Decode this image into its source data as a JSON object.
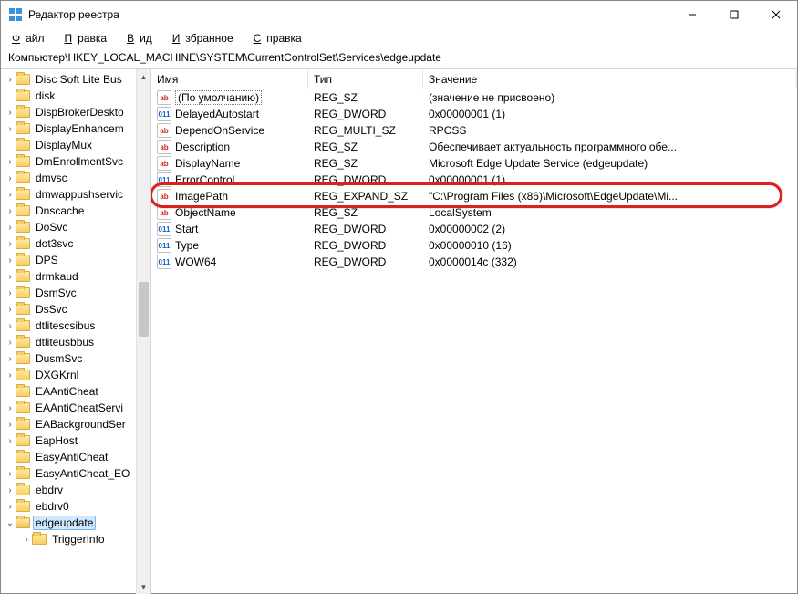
{
  "window": {
    "title": "Редактор реестра"
  },
  "menu": {
    "file": "Файл",
    "edit": "Правка",
    "view": "Вид",
    "favorites": "Избранное",
    "help": "Справка"
  },
  "address": "Компьютер\\HKEY_LOCAL_MACHINE\\SYSTEM\\CurrentControlSet\\Services\\edgeupdate",
  "tree": [
    {
      "label": "Disc Soft Lite Bus",
      "exp": true
    },
    {
      "label": "disk",
      "exp": false
    },
    {
      "label": "DispBrokerDeskto",
      "exp": true
    },
    {
      "label": "DisplayEnhancem",
      "exp": true
    },
    {
      "label": "DisplayMux",
      "exp": false
    },
    {
      "label": "DmEnrollmentSvc",
      "exp": true
    },
    {
      "label": "dmvsc",
      "exp": true
    },
    {
      "label": "dmwappushservic",
      "exp": true
    },
    {
      "label": "Dnscache",
      "exp": true
    },
    {
      "label": "DoSvc",
      "exp": true
    },
    {
      "label": "dot3svc",
      "exp": true
    },
    {
      "label": "DPS",
      "exp": true
    },
    {
      "label": "drmkaud",
      "exp": true
    },
    {
      "label": "DsmSvc",
      "exp": true
    },
    {
      "label": "DsSvc",
      "exp": true
    },
    {
      "label": "dtlitescsibus",
      "exp": true
    },
    {
      "label": "dtliteusbbus",
      "exp": true
    },
    {
      "label": "DusmSvc",
      "exp": true
    },
    {
      "label": "DXGKrnl",
      "exp": true
    },
    {
      "label": "EAAntiCheat",
      "exp": false
    },
    {
      "label": "EAAntiCheatServi",
      "exp": true
    },
    {
      "label": "EABackgroundSer",
      "exp": true
    },
    {
      "label": "EapHost",
      "exp": true
    },
    {
      "label": "EasyAntiCheat",
      "exp": false
    },
    {
      "label": "EasyAntiCheat_EO",
      "exp": true
    },
    {
      "label": "ebdrv",
      "exp": true
    },
    {
      "label": "ebdrv0",
      "exp": true
    },
    {
      "label": "edgeupdate",
      "exp": true,
      "open": true,
      "selected": true
    },
    {
      "label": "TriggerInfo",
      "exp": true,
      "child": true
    }
  ],
  "columns": {
    "name": "Имя",
    "type": "Тип",
    "value": "Значение"
  },
  "rows": [
    {
      "icon": "str",
      "name": "(По умолчанию)",
      "default": true,
      "type": "REG_SZ",
      "value": "(значение не присвоено)"
    },
    {
      "icon": "num",
      "name": "DelayedAutostart",
      "type": "REG_DWORD",
      "value": "0x00000001 (1)"
    },
    {
      "icon": "str",
      "name": "DependOnService",
      "type": "REG_MULTI_SZ",
      "value": "RPCSS"
    },
    {
      "icon": "str",
      "name": "Description",
      "type": "REG_SZ",
      "value": "Обеспечивает актуальность программного обе..."
    },
    {
      "icon": "str",
      "name": "DisplayName",
      "type": "REG_SZ",
      "value": "Microsoft Edge Update Service (edgeupdate)"
    },
    {
      "icon": "num",
      "name": "ErrorControl",
      "type": "REG_DWORD",
      "value": "0x00000001 (1)"
    },
    {
      "icon": "str",
      "name": "ImagePath",
      "type": "REG_EXPAND_SZ",
      "value": "\"C:\\Program Files (x86)\\Microsoft\\EdgeUpdate\\Mi...",
      "highlight": true
    },
    {
      "icon": "str",
      "name": "ObjectName",
      "type": "REG_SZ",
      "value": "LocalSystem"
    },
    {
      "icon": "num",
      "name": "Start",
      "type": "REG_DWORD",
      "value": "0x00000002 (2)"
    },
    {
      "icon": "num",
      "name": "Type",
      "type": "REG_DWORD",
      "value": "0x00000010 (16)"
    },
    {
      "icon": "num",
      "name": "WOW64",
      "type": "REG_DWORD",
      "value": "0x0000014c (332)"
    }
  ]
}
